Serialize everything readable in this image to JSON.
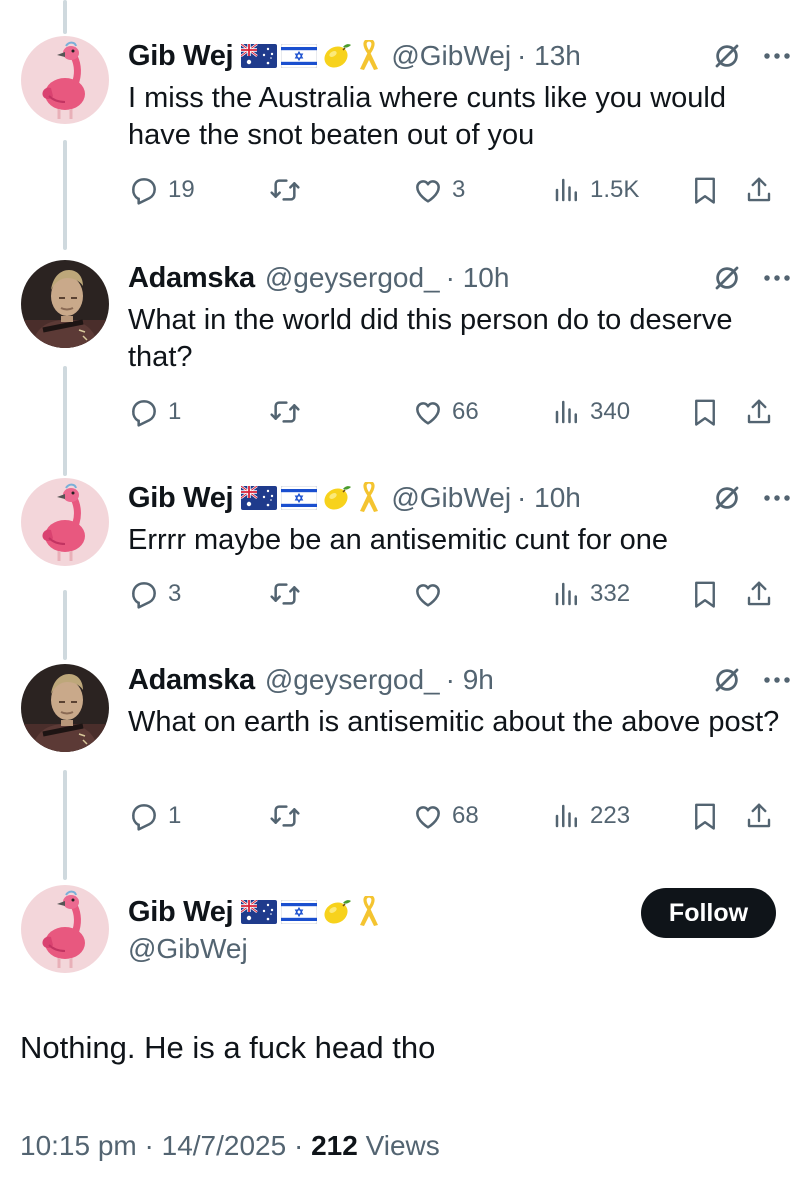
{
  "tweets": [
    {
      "name": "Gib Wej",
      "handle": "@GibWej",
      "time": "· 13h",
      "text": "I miss the Australia where cunts like you would have the snot beaten out of you",
      "replies": "19",
      "retweets": "",
      "likes": "3",
      "views": "1.5K"
    },
    {
      "name": "Adamska",
      "handle": "@geysergod_",
      "time": "· 10h",
      "text": "What in the world did this person do to deserve that?",
      "replies": "1",
      "retweets": "",
      "likes": "66",
      "views": "340"
    },
    {
      "name": "Gib Wej",
      "handle": "@GibWej",
      "time": "· 10h",
      "text": "Errrr maybe be an antisemitic cunt for one",
      "replies": "3",
      "retweets": "",
      "likes": "",
      "views": "332"
    },
    {
      "name": "Adamska",
      "handle": "@geysergod_",
      "time": "· 9h",
      "text": "What on earth is antisemitic about the above post?",
      "replies": "1",
      "retweets": "",
      "likes": "68",
      "views": "223"
    }
  ],
  "main_tweet": {
    "name": "Gib Wej",
    "handle": "@GibWej",
    "follow_label": "Follow",
    "text": "Nothing. He is a fuck head tho",
    "time": "10:15 pm · 14/7/2025 · ",
    "views_count": "212",
    "views_label": " Views"
  },
  "icons": {
    "reply": "reply-icon",
    "retweet": "retweet-icon",
    "like": "heart-icon",
    "views": "views-icon",
    "bookmark": "bookmark-icon",
    "share": "share-icon",
    "grok": "grok-icon",
    "more": "more-icon",
    "flags": [
      "australia-flag-icon",
      "israel-flag-icon",
      "lemon-icon",
      "yellow-ribbon-icon"
    ]
  },
  "colors": {
    "text": "#0f1419",
    "secondary": "#536471",
    "thread_line": "#cfd9de",
    "follow_bg": "#0f1419",
    "ribbon": "#f4c430"
  }
}
